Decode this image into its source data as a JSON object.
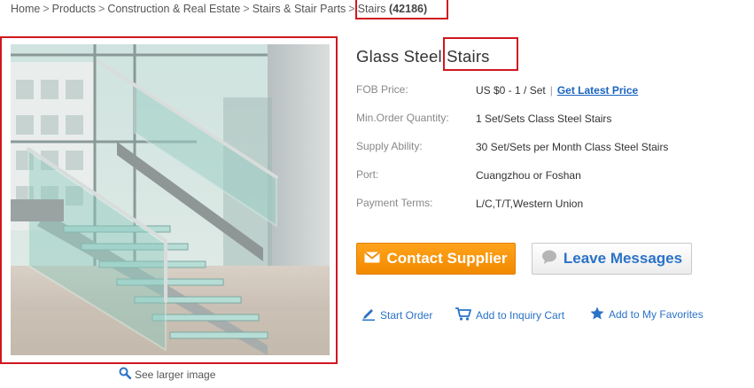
{
  "breadcrumb": {
    "items": [
      "Home",
      "Products",
      "Construction & Real Estate",
      "Stairs & Stair Parts"
    ],
    "separator": ">",
    "current": "Stairs",
    "count": "(42186)"
  },
  "product": {
    "title_part1": "Glass Steel",
    "title_part2": "Stairs",
    "see_larger": "See larger image"
  },
  "specs": [
    {
      "label": "FOB Price:",
      "value": "US $0 - 1 / Set",
      "link": "Get Latest Price"
    },
    {
      "label": "Min.Order Quantity:",
      "value": "1 Set/Sets Class Steel Stairs"
    },
    {
      "label": "Supply Ability:",
      "value": "30 Set/Sets per Month Class Steel Stairs"
    },
    {
      "label": "Port:",
      "value": "Cuangzhou or Foshan"
    },
    {
      "label": "Payment Terms:",
      "value": "L/C,T/T,Western Union"
    }
  ],
  "buttons": {
    "contact": "Contact Supplier",
    "leave": "Leave Messages"
  },
  "actions": {
    "start_order": "Start Order",
    "inquiry_cart": "Add to Inquiry Cart",
    "favorites": "Add to My Favorites"
  },
  "icons": {
    "contact": "envelope-icon",
    "leave": "chat-bubble-icon",
    "larger": "magnifier-icon",
    "start_order": "pen-icon",
    "inquiry_cart": "cart-icon",
    "favorites": "star-icon"
  },
  "colors": {
    "highlight": "#d0181e",
    "contact_button": "#f79400",
    "link_blue": "#2a72c8"
  }
}
